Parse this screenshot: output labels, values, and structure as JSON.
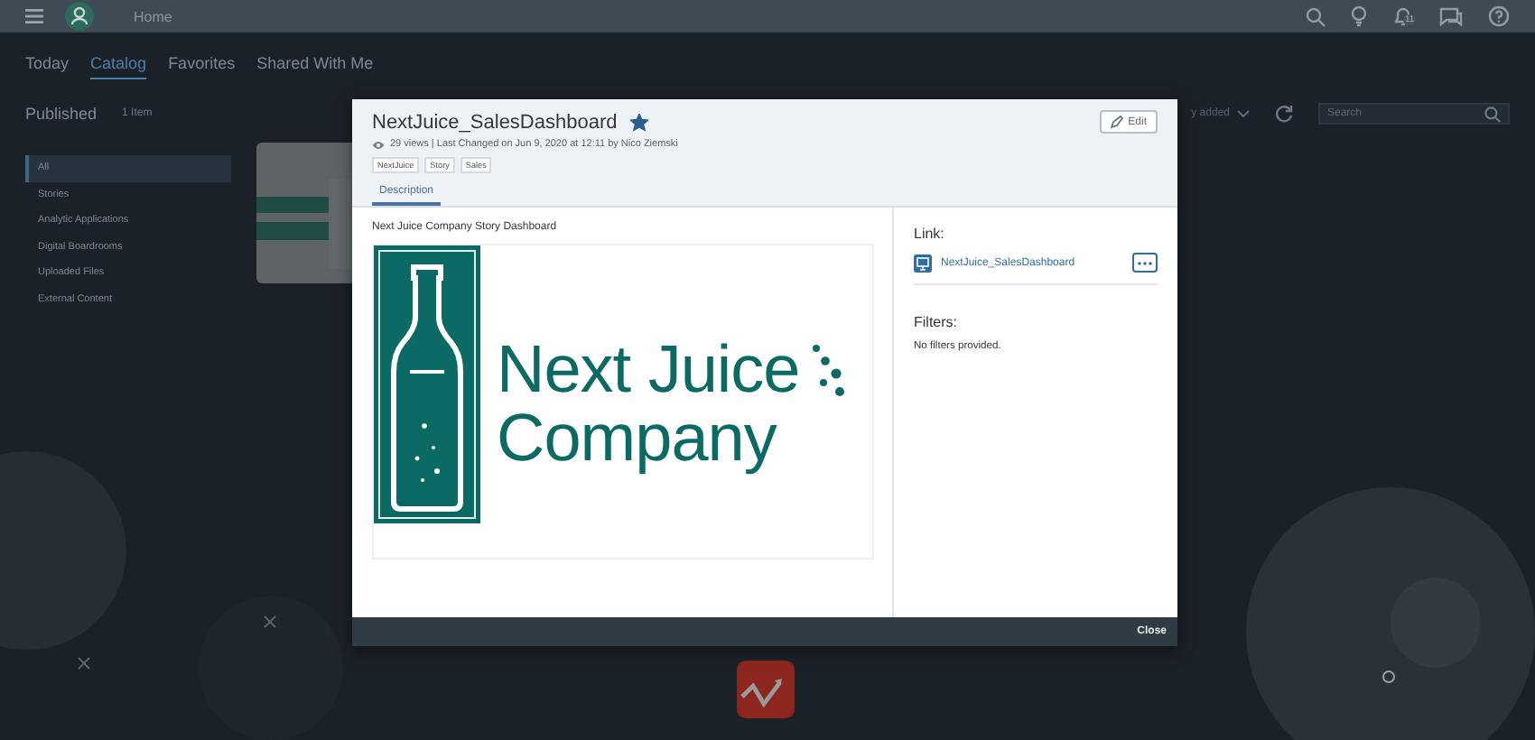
{
  "shell_bar": {
    "title": "Home",
    "notification_count": "11"
  },
  "tabs": [
    {
      "label": "Today",
      "selected": false
    },
    {
      "label": "Catalog",
      "selected": true
    },
    {
      "label": "Favorites",
      "selected": false
    },
    {
      "label": "Shared With Me",
      "selected": false
    }
  ],
  "header": {
    "title": "Published",
    "count": "1 Item"
  },
  "sidebar": {
    "items": [
      {
        "label": "All",
        "selected": true
      },
      {
        "label": "Stories",
        "selected": false
      },
      {
        "label": "Analytic Applications",
        "selected": false
      },
      {
        "label": "Digital Boardrooms",
        "selected": false
      },
      {
        "label": "Uploaded Files",
        "selected": false
      },
      {
        "label": "External Content",
        "selected": false
      }
    ]
  },
  "toolbar": {
    "sort": "y added",
    "search": {
      "placeholder": "Search"
    }
  },
  "dialog": {
    "title": "NextJuice_SalesDashboard",
    "favorite": true,
    "meta": "29 views | Last Changed on Jun 9, 2020 at 12:11 by Nico Ziemski",
    "tags": [
      "NextJuice",
      "Story",
      "Sales"
    ],
    "edit_button": "Edit",
    "tabs": [
      {
        "label": "Description",
        "selected": true
      }
    ],
    "description": "Next Juice Company Story Dashboard",
    "logo": {
      "lines": [
        "Next Juice",
        "Company"
      ]
    },
    "link": {
      "heading": "Link:",
      "label": "NextJuice_SalesDashboard"
    },
    "filters": {
      "heading": "Filters:",
      "text": "No filters provided."
    },
    "close_button": "Close"
  }
}
